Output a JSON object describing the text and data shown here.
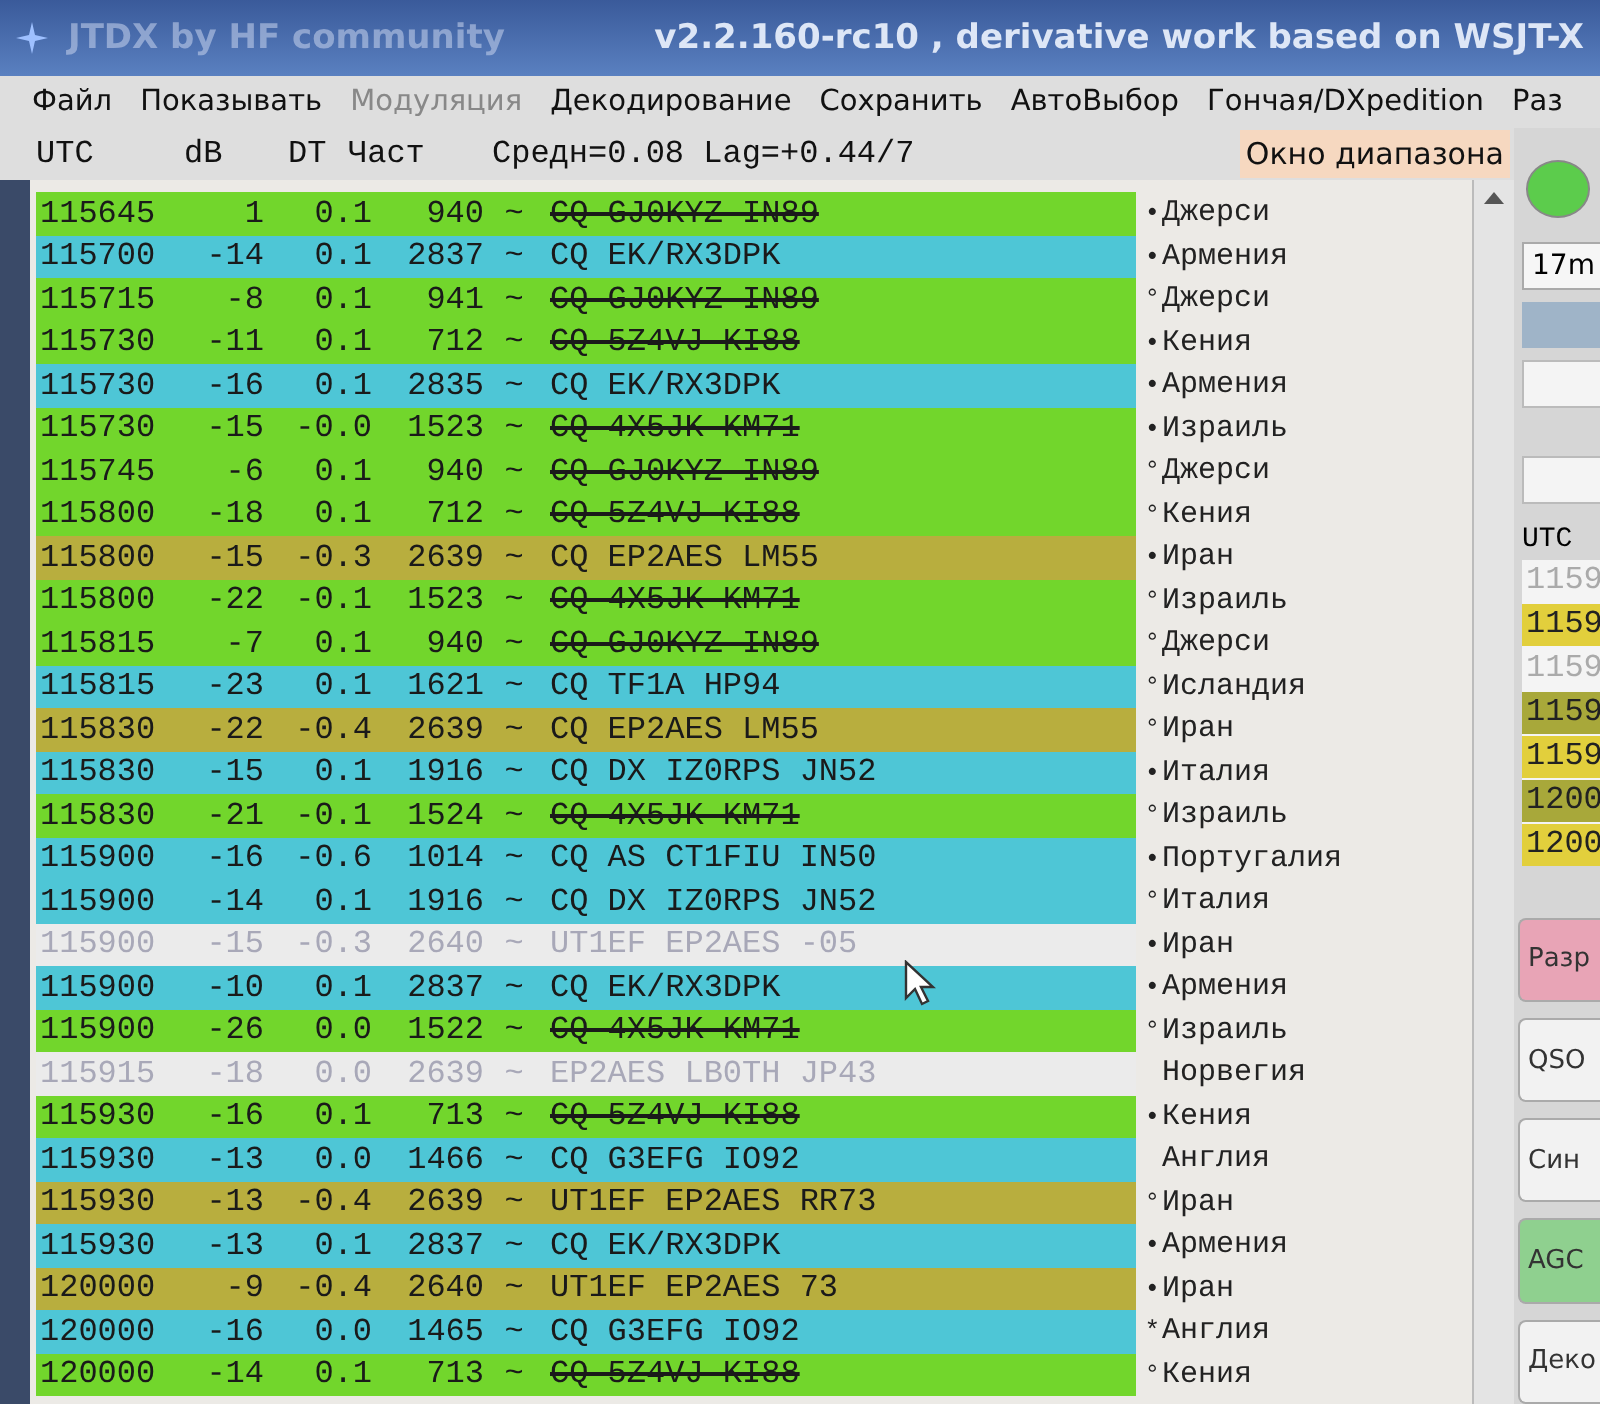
{
  "window": {
    "title": "JTDX by HF community",
    "version": "v2.2.160-rc10 , derivative work based on WSJT-X"
  },
  "menu": [
    {
      "label": "Файл",
      "disabled": false
    },
    {
      "label": "Показывать",
      "disabled": false
    },
    {
      "label": "Модуляция",
      "disabled": true
    },
    {
      "label": "Декодирование",
      "disabled": false
    },
    {
      "label": "Сохранить",
      "disabled": false
    },
    {
      "label": "АвтоВыбор",
      "disabled": false
    },
    {
      "label": "Гончая/DXpedition",
      "disabled": false
    },
    {
      "label": "Раз",
      "disabled": false
    }
  ],
  "header": {
    "columns": [
      "UTC",
      "dB",
      "DT",
      "Част"
    ],
    "stats": "Средн=0.08 Lag=+0.44/7",
    "band_window_label": "Окно диапазона"
  },
  "rows": [
    {
      "utc": "115645",
      "db": "1",
      "dt": "0.1",
      "freq": "940",
      "mode": "~",
      "message": "CQ GJ0KYZ IN89",
      "color": "#72d62c",
      "struck": true,
      "faded": false,
      "marker": "•",
      "country": "Джерси"
    },
    {
      "utc": "115700",
      "db": "-14",
      "dt": "0.1",
      "freq": "2837",
      "mode": "~",
      "message": "CQ EK/RX3DPK",
      "color": "#4ec6d6",
      "struck": false,
      "faded": false,
      "marker": "•",
      "country": "Армения"
    },
    {
      "utc": "115715",
      "db": "-8",
      "dt": "0.1",
      "freq": "941",
      "mode": "~",
      "message": "CQ GJ0KYZ IN89",
      "color": "#72d62c",
      "struck": true,
      "faded": false,
      "marker": "°",
      "country": "Джерси"
    },
    {
      "utc": "115730",
      "db": "-11",
      "dt": "0.1",
      "freq": "712",
      "mode": "~",
      "message": "CQ 5Z4VJ KI88",
      "color": "#72d62c",
      "struck": true,
      "faded": false,
      "marker": "•",
      "country": "Кения"
    },
    {
      "utc": "115730",
      "db": "-16",
      "dt": "0.1",
      "freq": "2835",
      "mode": "~",
      "message": "CQ EK/RX3DPK",
      "color": "#4ec6d6",
      "struck": false,
      "faded": false,
      "marker": "•",
      "country": "Армения"
    },
    {
      "utc": "115730",
      "db": "-15",
      "dt": "-0.0",
      "freq": "1523",
      "mode": "~",
      "message": "CQ 4X5JK KM71",
      "color": "#72d62c",
      "struck": true,
      "faded": false,
      "marker": "•",
      "country": "Израиль"
    },
    {
      "utc": "115745",
      "db": "-6",
      "dt": "0.1",
      "freq": "940",
      "mode": "~",
      "message": "CQ GJ0KYZ IN89",
      "color": "#72d62c",
      "struck": true,
      "faded": false,
      "marker": "°",
      "country": "Джерси"
    },
    {
      "utc": "115800",
      "db": "-18",
      "dt": "0.1",
      "freq": "712",
      "mode": "~",
      "message": "CQ 5Z4VJ KI88",
      "color": "#72d62c",
      "struck": true,
      "faded": false,
      "marker": "°",
      "country": "Кения"
    },
    {
      "utc": "115800",
      "db": "-15",
      "dt": "-0.3",
      "freq": "2639",
      "mode": "~",
      "message": "CQ EP2AES LM55",
      "color": "#b8ae3e",
      "struck": false,
      "faded": false,
      "marker": "•",
      "country": "Иран"
    },
    {
      "utc": "115800",
      "db": "-22",
      "dt": "-0.1",
      "freq": "1523",
      "mode": "~",
      "message": "CQ 4X5JK KM71",
      "color": "#72d62c",
      "struck": true,
      "faded": false,
      "marker": "°",
      "country": "Израиль"
    },
    {
      "utc": "115815",
      "db": "-7",
      "dt": "0.1",
      "freq": "940",
      "mode": "~",
      "message": "CQ GJ0KYZ IN89",
      "color": "#72d62c",
      "struck": true,
      "faded": false,
      "marker": "°",
      "country": "Джерси"
    },
    {
      "utc": "115815",
      "db": "-23",
      "dt": "0.1",
      "freq": "1621",
      "mode": "~",
      "message": "CQ TF1A HP94",
      "color": "#4ec6d6",
      "struck": false,
      "faded": false,
      "marker": "°",
      "country": "Исландия"
    },
    {
      "utc": "115830",
      "db": "-22",
      "dt": "-0.4",
      "freq": "2639",
      "mode": "~",
      "message": "CQ EP2AES LM55",
      "color": "#b8ae3e",
      "struck": false,
      "faded": false,
      "marker": "°",
      "country": "Иран"
    },
    {
      "utc": "115830",
      "db": "-15",
      "dt": "0.1",
      "freq": "1916",
      "mode": "~",
      "message": "CQ DX IZ0RPS JN52",
      "color": "#4ec6d6",
      "struck": false,
      "faded": false,
      "marker": "•",
      "country": "Италия"
    },
    {
      "utc": "115830",
      "db": "-21",
      "dt": "-0.1",
      "freq": "1524",
      "mode": "~",
      "message": "CQ 4X5JK KM71",
      "color": "#72d62c",
      "struck": true,
      "faded": false,
      "marker": "°",
      "country": "Израиль"
    },
    {
      "utc": "115900",
      "db": "-16",
      "dt": "-0.6",
      "freq": "1014",
      "mode": "~",
      "message": "CQ AS CT1FIU IN50",
      "color": "#4ec6d6",
      "struck": false,
      "faded": false,
      "marker": "•",
      "country": "Португалия"
    },
    {
      "utc": "115900",
      "db": "-14",
      "dt": "0.1",
      "freq": "1916",
      "mode": "~",
      "message": "CQ DX IZ0RPS JN52",
      "color": "#4ec6d6",
      "struck": false,
      "faded": false,
      "marker": "°",
      "country": "Италия"
    },
    {
      "utc": "115900",
      "db": "-15",
      "dt": "-0.3",
      "freq": "2640",
      "mode": "~",
      "message": "UT1EF EP2AES -05",
      "color": "#ebebeb",
      "struck": false,
      "faded": true,
      "marker": "•",
      "country": "Иран"
    },
    {
      "utc": "115900",
      "db": "-10",
      "dt": "0.1",
      "freq": "2837",
      "mode": "~",
      "message": "CQ EK/RX3DPK",
      "color": "#4ec6d6",
      "struck": false,
      "faded": false,
      "marker": "•",
      "country": "Армения"
    },
    {
      "utc": "115900",
      "db": "-26",
      "dt": "0.0",
      "freq": "1522",
      "mode": "~",
      "message": "CQ 4X5JK KM71",
      "color": "#72d62c",
      "struck": true,
      "faded": false,
      "marker": "°",
      "country": "Израиль"
    },
    {
      "utc": "115915",
      "db": "-18",
      "dt": "0.0",
      "freq": "2639",
      "mode": "~",
      "message": "EP2AES LB0TH JP43",
      "color": "#ebebeb",
      "struck": false,
      "faded": true,
      "marker": "",
      "country": "Норвегия"
    },
    {
      "utc": "115930",
      "db": "-16",
      "dt": "0.1",
      "freq": "713",
      "mode": "~",
      "message": "CQ 5Z4VJ KI88",
      "color": "#72d62c",
      "struck": true,
      "faded": false,
      "marker": "•",
      "country": "Кения"
    },
    {
      "utc": "115930",
      "db": "-13",
      "dt": "0.0",
      "freq": "1466",
      "mode": "~",
      "message": "CQ G3EFG IO92",
      "color": "#4ec6d6",
      "struck": false,
      "faded": false,
      "marker": "",
      "country": "Англия"
    },
    {
      "utc": "115930",
      "db": "-13",
      "dt": "-0.4",
      "freq": "2639",
      "mode": "~",
      "message": "UT1EF EP2AES RR73",
      "color": "#b8ae3e",
      "struck": false,
      "faded": false,
      "marker": "°",
      "country": "Иран"
    },
    {
      "utc": "115930",
      "db": "-13",
      "dt": "0.1",
      "freq": "2837",
      "mode": "~",
      "message": "CQ EK/RX3DPK",
      "color": "#4ec6d6",
      "struck": false,
      "faded": false,
      "marker": "•",
      "country": "Армения"
    },
    {
      "utc": "120000",
      "db": "-9",
      "dt": "-0.4",
      "freq": "2640",
      "mode": "~",
      "message": "UT1EF EP2AES 73",
      "color": "#b8ae3e",
      "struck": false,
      "faded": false,
      "marker": "•",
      "country": "Иран"
    },
    {
      "utc": "120000",
      "db": "-16",
      "dt": "0.0",
      "freq": "1465",
      "mode": "~",
      "message": "CQ G3EFG IO92",
      "color": "#4ec6d6",
      "struck": false,
      "faded": false,
      "marker": "*",
      "country": "Англия"
    },
    {
      "utc": "120000",
      "db": "-14",
      "dt": "0.1",
      "freq": "713",
      "mode": "~",
      "message": "CQ 5Z4VJ KI88",
      "color": "#72d62c",
      "struck": true,
      "faded": false,
      "marker": "°",
      "country": "Кения"
    }
  ],
  "side_panel": {
    "band": "17m",
    "list_label": "UTC",
    "list": [
      {
        "text": "1159",
        "color": "#f4f4f4",
        "faded": true
      },
      {
        "text": "1159",
        "color": "#e2cf3c",
        "faded": false
      },
      {
        "text": "1159",
        "color": "#f4f4f4",
        "faded": true
      },
      {
        "text": "1159",
        "color": "#a8a83a",
        "faded": false
      },
      {
        "text": "1159",
        "color": "#e2cf3c",
        "faded": false
      },
      {
        "text": "1200",
        "color": "#a8a83a",
        "faded": false
      },
      {
        "text": "1200",
        "color": "#e2cf3c",
        "faded": false
      }
    ],
    "buttons": [
      {
        "label": "Разр",
        "color": "#e8a4b6"
      },
      {
        "label": "QSO",
        "color": "#f2f2f2"
      },
      {
        "label": "Син",
        "color": "#f2f2f2"
      },
      {
        "label": "AGC",
        "color": "#8fd08f"
      },
      {
        "label": "Деко",
        "color": "#f2f2f2"
      }
    ]
  }
}
